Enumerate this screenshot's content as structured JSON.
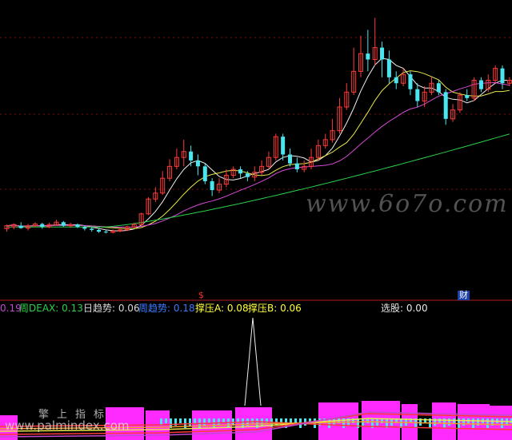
{
  "readouts": [
    {
      "label": ".19",
      "value": ""
    },
    {
      "label": "周DEAX",
      "value": "0.13"
    },
    {
      "label": "日趋势",
      "value": "0.06"
    },
    {
      "label": "周趋势",
      "value": "0.18"
    },
    {
      "label": "撑压A",
      "value": "0.08"
    },
    {
      "label": "撑压B",
      "value": "0.06"
    },
    {
      "label": "选股",
      "value": "0.00"
    }
  ],
  "readout_text": {
    "r1": "0.19",
    "r2": "周DEAX: 0.13",
    "r3": "日趋势: 0.06",
    "r4": "周趋势: 0.18",
    "r5": "撑压A: 0.08",
    "r6": "撑压B: 0.06",
    "r7": "选股: 0.00"
  },
  "markers": {
    "s": "$",
    "cai": "财"
  },
  "watermarks": {
    "site": "www.6o7o.com",
    "site2": "www.palmindex.com",
    "cn": "擎上指标"
  },
  "colors": {
    "up": "#ff3a3a",
    "down": "#4ae6f0",
    "ma_white": "#f0f0f0",
    "ma_yellow": "#e8e84a",
    "ma_magenta": "#d84ad8",
    "ma_green": "#2ad24a",
    "separator": "#b02020",
    "bar_magenta": "#ff2aff",
    "background": "#000000"
  },
  "chart_data": {
    "type": "candlestick",
    "candles": [
      [
        0.55,
        0.6,
        0.5,
        0.62
      ],
      [
        0.58,
        0.62,
        0.54,
        0.64
      ],
      [
        0.6,
        0.56,
        0.55,
        0.66
      ],
      [
        0.56,
        0.6,
        0.52,
        0.63
      ],
      [
        0.6,
        0.63,
        0.58,
        0.66
      ],
      [
        0.63,
        0.58,
        0.55,
        0.65
      ],
      [
        0.58,
        0.62,
        0.56,
        0.65
      ],
      [
        0.62,
        0.66,
        0.6,
        0.7
      ],
      [
        0.66,
        0.6,
        0.58,
        0.68
      ],
      [
        0.6,
        0.62,
        0.57,
        0.65
      ],
      [
        0.62,
        0.58,
        0.56,
        0.64
      ],
      [
        0.58,
        0.55,
        0.52,
        0.6
      ],
      [
        0.55,
        0.53,
        0.5,
        0.58
      ],
      [
        0.53,
        0.5,
        0.48,
        0.56
      ],
      [
        0.5,
        0.49,
        0.47,
        0.53
      ],
      [
        0.49,
        0.51,
        0.47,
        0.54
      ],
      [
        0.51,
        0.53,
        0.49,
        0.56
      ],
      [
        0.53,
        0.58,
        0.51,
        0.6
      ],
      [
        0.58,
        0.62,
        0.56,
        0.65
      ],
      [
        0.62,
        0.8,
        0.6,
        0.82
      ],
      [
        0.8,
        1.05,
        0.78,
        1.08
      ],
      [
        1.05,
        1.15,
        1.0,
        1.25
      ],
      [
        1.15,
        1.4,
        1.12,
        1.52
      ],
      [
        1.4,
        1.6,
        1.35,
        1.72
      ],
      [
        1.6,
        1.75,
        1.55,
        1.9
      ],
      [
        1.75,
        1.85,
        1.6,
        2.05
      ],
      [
        1.85,
        1.7,
        1.6,
        1.95
      ],
      [
        1.7,
        1.6,
        1.45,
        1.8
      ],
      [
        1.6,
        1.35,
        1.3,
        1.65
      ],
      [
        1.35,
        1.2,
        1.1,
        1.4
      ],
      [
        1.2,
        1.3,
        1.15,
        1.4
      ],
      [
        1.3,
        1.45,
        1.25,
        1.55
      ],
      [
        1.45,
        1.55,
        1.4,
        1.6
      ],
      [
        1.55,
        1.48,
        1.4,
        1.6
      ],
      [
        1.48,
        1.42,
        1.35,
        1.52
      ],
      [
        1.42,
        1.5,
        1.35,
        1.6
      ],
      [
        1.5,
        1.6,
        1.45,
        1.7
      ],
      [
        1.6,
        1.75,
        1.55,
        1.85
      ],
      [
        1.75,
        2.1,
        1.7,
        2.15
      ],
      [
        2.1,
        1.8,
        1.7,
        2.15
      ],
      [
        1.8,
        1.65,
        1.6,
        1.9
      ],
      [
        1.65,
        1.55,
        1.5,
        1.75
      ],
      [
        1.55,
        1.6,
        1.5,
        1.7
      ],
      [
        1.6,
        1.75,
        1.55,
        1.9
      ],
      [
        1.75,
        1.95,
        1.7,
        2.05
      ],
      [
        1.95,
        2.05,
        1.9,
        2.15
      ],
      [
        2.05,
        2.2,
        2.0,
        2.4
      ],
      [
        2.2,
        2.6,
        2.15,
        2.75
      ],
      [
        2.6,
        2.85,
        2.55,
        3.0
      ],
      [
        2.85,
        3.2,
        2.8,
        3.6
      ],
      [
        3.2,
        3.5,
        3.1,
        3.8
      ],
      [
        3.5,
        3.4,
        3.2,
        3.9
      ],
      [
        3.4,
        3.6,
        3.3,
        4.1
      ],
      [
        3.6,
        3.4,
        3.1,
        3.7
      ],
      [
        3.4,
        3.1,
        3.0,
        3.55
      ],
      [
        3.1,
        3.0,
        2.9,
        3.2
      ],
      [
        3.0,
        3.15,
        2.95,
        3.25
      ],
      [
        3.15,
        2.9,
        2.8,
        3.2
      ],
      [
        2.9,
        2.7,
        2.6,
        3.0
      ],
      [
        2.7,
        2.85,
        2.6,
        2.95
      ],
      [
        2.85,
        3.0,
        2.8,
        3.1
      ],
      [
        3.0,
        2.85,
        2.8,
        3.05
      ],
      [
        2.85,
        2.4,
        2.3,
        2.9
      ],
      [
        2.4,
        2.55,
        2.35,
        2.65
      ],
      [
        2.55,
        2.8,
        2.5,
        2.85
      ],
      [
        2.8,
        2.75,
        2.7,
        2.9
      ],
      [
        2.75,
        3.05,
        2.7,
        3.1
      ],
      [
        3.05,
        2.9,
        2.85,
        3.1
      ],
      [
        2.9,
        3.05,
        2.85,
        3.15
      ],
      [
        3.05,
        3.25,
        3.0,
        3.3
      ],
      [
        3.25,
        3.0,
        2.9,
        3.3
      ],
      [
        3.0,
        3.05,
        2.95,
        3.1
      ]
    ],
    "note": "candles as [open, close, low, high]"
  }
}
